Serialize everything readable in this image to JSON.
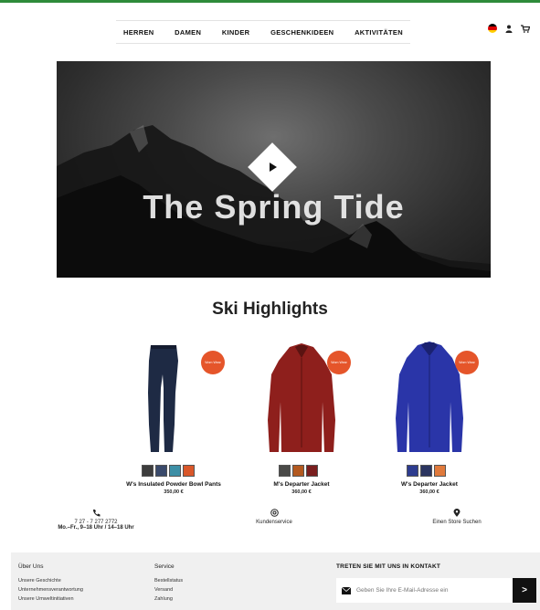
{
  "nav": {
    "items": [
      {
        "label": "HERREN"
      },
      {
        "label": "DAMEN"
      },
      {
        "label": "KINDER"
      },
      {
        "label": "GESCHENKIDEEN"
      },
      {
        "label": "AKTIVITÄTEN"
      }
    ]
  },
  "header_icons": {
    "flag": "germany-flag-icon",
    "account": "user-icon",
    "cart": "cart-icon"
  },
  "hero": {
    "title": "The Spring Tide",
    "play_icon": "play-icon"
  },
  "section": {
    "title": "Ski Highlights"
  },
  "products": [
    {
      "name": "W's Insulated Powder Bowl Pants",
      "price": "350,00 €",
      "badge": "Worn Wear",
      "garment_color": "#1e2a44",
      "swatches": [
        "#3d3d3d",
        "#3a4a6b",
        "#3d8fa6",
        "#d9572a"
      ]
    },
    {
      "name": "M's Departer Jacket",
      "price": "360,00 €",
      "badge": "Worn Wear",
      "garment_color": "#8e1f1c",
      "swatches": [
        "#4a4a48",
        "#b3591f",
        "#7a1e1e"
      ]
    },
    {
      "name": "W's Departer Jacket",
      "price": "360,00 €",
      "badge": "Worn Wear",
      "garment_color": "#2a35a8",
      "swatches": [
        "#2d3c8f",
        "#2b3560",
        "#e07a3c"
      ]
    }
  ],
  "contact": {
    "phone": "7 27 - 7 277 2772",
    "hours": "Mo.–Fr., 9–18 Uhr / 14–18 Uhr",
    "service": "Kundenservice",
    "store": "Einen Store Suchen"
  },
  "footer": {
    "col1_title": "Über Uns",
    "col1_links": [
      "Unsere Geschichte",
      "Unternehmensverantwortung",
      "Unsere Umweltinitiativen"
    ],
    "col2_title": "Service",
    "col2_links": [
      "Bestellstatus",
      "Versand",
      "Zahlung"
    ],
    "contact_title": "TRETEN SIE MIT UNS IN KONTAKT",
    "email_placeholder": "Geben Sie Ihre E-Mail-Adresse ein",
    "submit_label": ">"
  },
  "colors": {
    "accent_line": "#2e8b3a",
    "badge": "#e5552a"
  }
}
